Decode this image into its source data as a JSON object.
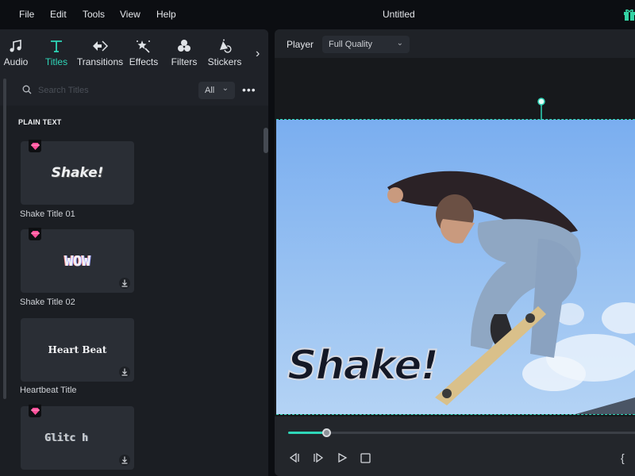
{
  "menubar": {
    "items": [
      "File",
      "Edit",
      "Tools",
      "View",
      "Help"
    ],
    "title": "Untitled",
    "gift_icon": "gift-icon"
  },
  "left_panel": {
    "tabs": [
      {
        "label": "Audio",
        "icon": "music-note-icon",
        "active": false
      },
      {
        "label": "Titles",
        "icon": "text-t-icon",
        "active": true
      },
      {
        "label": "Transitions",
        "icon": "transition-arrows-icon",
        "active": false
      },
      {
        "label": "Effects",
        "icon": "magic-wand-icon",
        "active": false
      },
      {
        "label": "Filters",
        "icon": "filter-circles-icon",
        "active": false
      },
      {
        "label": "Stickers",
        "icon": "sticker-icon",
        "active": false
      }
    ],
    "more_tabs": "›",
    "search": {
      "placeholder": "Search Titles",
      "value": ""
    },
    "filter": {
      "selected": "All",
      "chevron": "⌄"
    },
    "more_menu": "•••",
    "section_title": "PLAIN TEXT",
    "items": [
      {
        "label": "Shake Title 01",
        "preview": "Shake!",
        "premium": true,
        "downloadable": false
      },
      {
        "label": "Shake Title 02",
        "preview": "WOW",
        "premium": true,
        "downloadable": true
      },
      {
        "label": "Heartbeat Title",
        "preview": "Heart Beat",
        "premium": false,
        "downloadable": true
      },
      {
        "label": "",
        "preview": "Glitc h",
        "premium": true,
        "downloadable": true
      }
    ]
  },
  "player": {
    "label": "Player",
    "quality": "Full Quality",
    "chevron": "⌄",
    "overlay_text": "Shake!",
    "progress": 0.11,
    "controls": [
      "prev-frame",
      "next-frame",
      "play",
      "stop"
    ],
    "mark_in": "{"
  },
  "colors": {
    "accent": "#2fd6b8",
    "background": "#0c0e12",
    "panel": "#1b1e23"
  }
}
